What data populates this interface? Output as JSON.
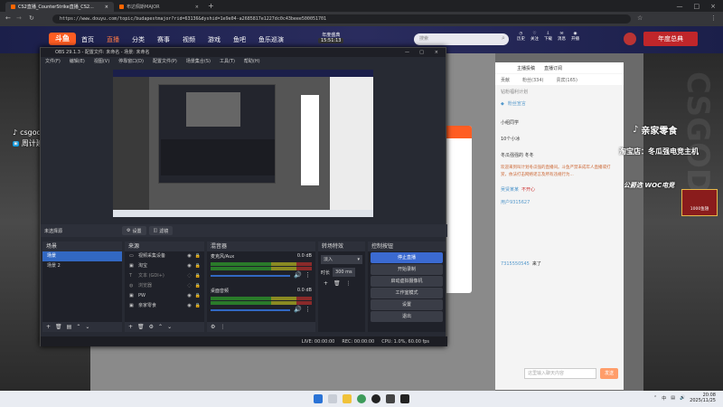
{
  "browser": {
    "tabs": [
      {
        "label": "CS2直播_CounterStrike直播_CS2..."
      },
      {
        "label": "布达佩斯MAJOR"
      }
    ],
    "url": "https://www.douyu.com/topic/budapestmajor?rid=63136&dyshid=1e9e04-a2685817e1227dc0c43beee500051701"
  },
  "douyu": {
    "logo": "斗鱼",
    "nav": [
      "首页",
      "直播",
      "分类",
      "赛事",
      "视频",
      "游戏",
      "鱼吧",
      "鱼乐巡演"
    ],
    "timer_label": "年度盛典",
    "timer": "15:51:13",
    "search_placeholder": "搜索",
    "header_icons": [
      "历史",
      "关注",
      "下载",
      "消息",
      "开播"
    ],
    "right_badge": "年度总典",
    "overlay_left": [
      "csgodg",
      "周计建_冬瓜强"
    ],
    "overlay_right_title": "亲家零食",
    "overlay_right_sub": "淘宝店：冬瓜强电竞主机",
    "overlay_right_brand": "公爵选 WOC电竞",
    "chat_top": [
      "主播投稿",
      "直播订阅"
    ],
    "chat_tabs": [
      "贡献",
      "粉丝(334)",
      "贵宾(165)"
    ],
    "chat_notice": "钻粉福利计划",
    "chat_notice2": "粉丝宣言",
    "chat_msgs": [
      "欢迎来到叫计划冬瓜强的直播间。斗鱼严禁未成年人直播或打赏，依法打击网络谣言及所有违规行为...",
      "小组同学",
      "10个小冰",
      "冬瓜强强的 冬冬"
    ],
    "chat_user1": "吴贤某某",
    "chat_user1_msg": "不开心",
    "chat_user2": "用户9315627",
    "chat_user3": "7315550545",
    "chat_user3_msg": "来了",
    "chat_input_placeholder": "这里输入聊天内容",
    "chat_send": "发送",
    "gift_count": "1000鱼翅"
  },
  "obs": {
    "title": "OBS 29.1.3 - 配置文件: 未命名 - 场景: 未命名",
    "menu": [
      "文件(F)",
      "编辑(E)",
      "视图(V)",
      "停靠窗口(D)",
      "配置文件(P)",
      "场景集合(S)",
      "工具(T)",
      "帮助(H)"
    ],
    "no_source": "未选择源",
    "settings_btn": "设置",
    "filters_btn": "滤镜",
    "docks": {
      "scenes": {
        "title": "场景",
        "items": [
          "场景",
          "场景 2"
        ]
      },
      "sources": {
        "title": "来源",
        "items": [
          "视频采集设备",
          "淘宝",
          "文本 (GDI+)",
          "浏览器",
          "PW",
          "亲家零食"
        ]
      },
      "mixer": {
        "title": "混音器",
        "tracks": [
          {
            "name": "麦克风/Aux",
            "db": "0.0 dB"
          },
          {
            "name": "桌面音频",
            "db": "0.0 dB"
          }
        ]
      },
      "transitions": {
        "title": "转场特效",
        "type": "淡入",
        "duration_label": "时长",
        "duration": "300 ms"
      },
      "controls": {
        "title": "控制按钮",
        "buttons": [
          "停止直播",
          "开始录制",
          "启动虚拟摄像机",
          "工作室模式",
          "设置",
          "退出"
        ]
      }
    },
    "status": {
      "live": "LIVE: 00:00:00",
      "rec": "REC: 00:00:00",
      "cpu": "CPU: 1.0%, 60.00 fps"
    }
  },
  "taskbar": {
    "time": "20:08",
    "date": "2025/11/25",
    "lang": "中"
  },
  "colors": {
    "obs_blue": "#3268c2",
    "douyu_orange": "#ff5d23"
  }
}
